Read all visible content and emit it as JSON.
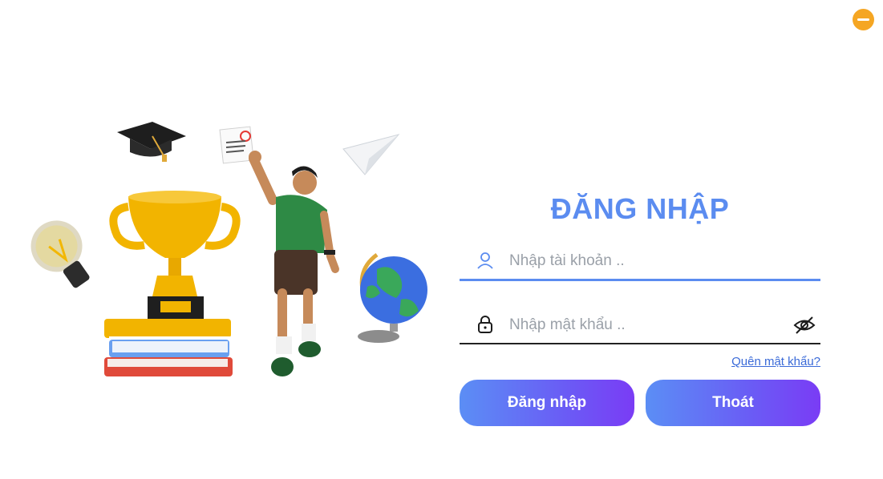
{
  "window": {
    "minimize_icon": "minus-circle-icon",
    "accent_color": "#f5a623"
  },
  "login": {
    "title": "ĐĂNG NHẬP",
    "username_placeholder": "Nhập tài khoản ..",
    "password_placeholder": "Nhập mật khẩu ..",
    "forgot_password": "Quên mật khẩu?",
    "login_button": "Đăng nhập",
    "exit_button": "Thoát",
    "primary_color": "#5b8cf0"
  },
  "icons": [
    "user-icon",
    "lock-icon",
    "eye-slash-icon"
  ]
}
